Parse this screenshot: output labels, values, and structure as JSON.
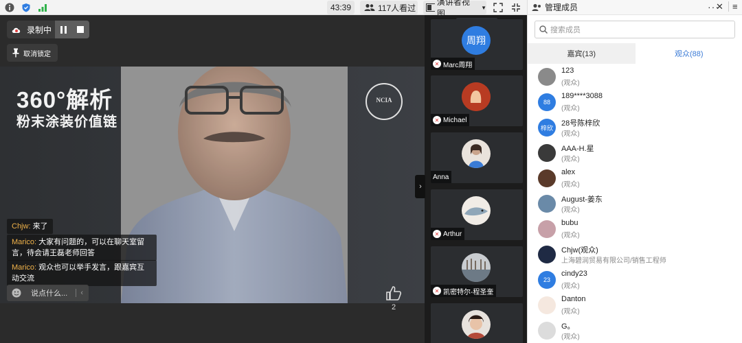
{
  "topbar": {
    "timer": "43:39",
    "viewers": "117人看过",
    "view_mode": "演讲者视图"
  },
  "stage": {
    "slide_title1": "360°解析",
    "slide_title2": "粉末涂装价值链",
    "slide_logo_text": "NCIA",
    "recording_label": "录制中",
    "unpin_label": "取消锁定",
    "chat": [
      {
        "name": "Chjw: ",
        "text": "来了"
      },
      {
        "name": "Marico: ",
        "text": "大家有问题的，可以在聊天室留言，待会请王磊老师回答"
      },
      {
        "name": "Marico: ",
        "text": "观众也可以举手发言，跟嘉宾互动交流"
      }
    ],
    "say_placeholder": "说点什么...",
    "likes": "2"
  },
  "guests": [
    {
      "name": "Marc周翔",
      "avatar_text": "周翔"
    },
    {
      "name": "Michael",
      "avatar_text": ""
    },
    {
      "name": "Anna",
      "avatar_text": ""
    },
    {
      "name": "Arthur",
      "avatar_text": ""
    },
    {
      "name": "凯密特尔-程圣奎",
      "avatar_text": ""
    },
    {
      "name": "",
      "avatar_text": ""
    }
  ],
  "panel": {
    "title": "管理成员",
    "search_placeholder": "搜索成员",
    "tab_guests": "嘉宾(13)",
    "tab_audience": "观众(88)",
    "members": [
      {
        "name": "123",
        "role": "(观众)",
        "avatar": "",
        "color": "#8a8a8a"
      },
      {
        "name": "189****3088",
        "role": "(观众)",
        "avatar": "88",
        "color": "#2f7de1"
      },
      {
        "name": "28号陈梓欣",
        "role": "(观众)",
        "avatar": "梓欣",
        "color": "#2f7de1"
      },
      {
        "name": "AAA-H.星",
        "role": "(观众)",
        "avatar": "",
        "color": "#3a3a3a"
      },
      {
        "name": "alex",
        "role": "(观众)",
        "avatar": "",
        "color": "#5a3a2a"
      },
      {
        "name": "August-姜东",
        "role": "(观众)",
        "avatar": "",
        "color": "#6a8aa8"
      },
      {
        "name": "bubu",
        "role": "(观众)",
        "avatar": "",
        "color": "#c7a0a8"
      },
      {
        "name": "Chjw(观众)",
        "role": "上海碧润贸易有限公司/销售工程师",
        "avatar": "",
        "color": "#1f2a44"
      },
      {
        "name": "cindy23",
        "role": "(观众)",
        "avatar": "23",
        "color": "#2f7de1"
      },
      {
        "name": "Danton",
        "role": "(观众)",
        "avatar": "",
        "color": "#f5e8df"
      },
      {
        "name": "G。",
        "role": "(观众)",
        "avatar": "",
        "color": "#dcdcdc"
      }
    ]
  }
}
